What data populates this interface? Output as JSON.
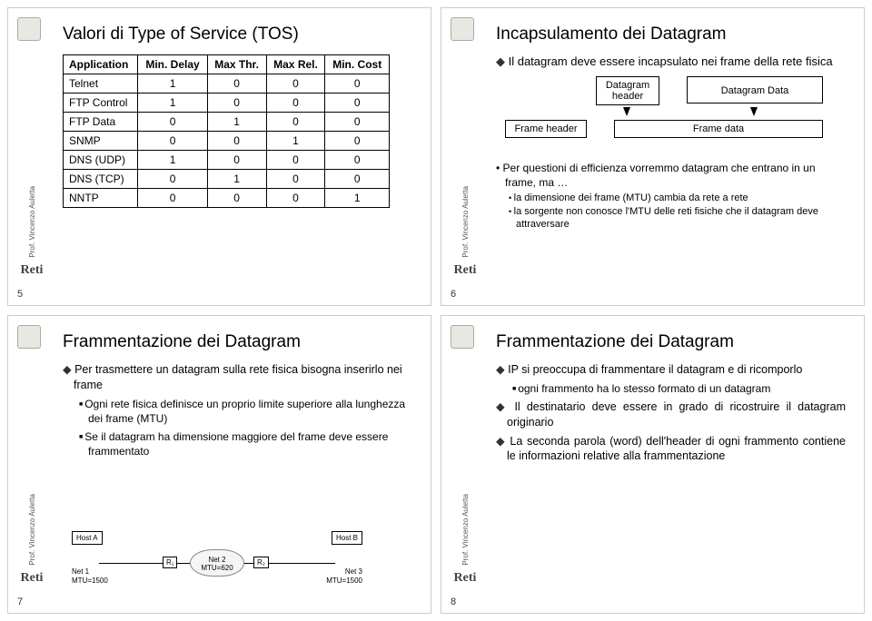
{
  "sidebar_author": "Prof. Vincenzo Auletta",
  "sidebar_logo": "Reti",
  "slide5": {
    "title": "Valori di Type of Service (TOS)",
    "pagenum": "5",
    "table": {
      "headers": [
        "Application",
        "Min. Delay",
        "Max Thr.",
        "Max Rel.",
        "Min. Cost"
      ],
      "rows": [
        {
          "c0": "Telnet",
          "c1": "1",
          "c2": "0",
          "c3": "0",
          "c4": "0"
        },
        {
          "c0": "FTP Control",
          "c1": "1",
          "c2": "0",
          "c3": "0",
          "c4": "0"
        },
        {
          "c0": "FTP Data",
          "c1": "0",
          "c2": "1",
          "c3": "0",
          "c4": "0"
        },
        {
          "c0": "SNMP",
          "c1": "0",
          "c2": "0",
          "c3": "1",
          "c4": "0"
        },
        {
          "c0": "DNS (UDP)",
          "c1": "1",
          "c2": "0",
          "c3": "0",
          "c4": "0"
        },
        {
          "c0": "DNS (TCP)",
          "c1": "0",
          "c2": "1",
          "c3": "0",
          "c4": "0"
        },
        {
          "c0": "NNTP",
          "c1": "0",
          "c2": "0",
          "c3": "0",
          "c4": "1"
        }
      ]
    }
  },
  "slide6": {
    "title": "Incapsulamento dei Datagram",
    "pagenum": "6",
    "lead": "Il datagram deve essere incapsulato nei frame della rete fisica",
    "boxes": {
      "dgram_header": "Datagram header",
      "dgram_data": "Datagram Data",
      "frame_header": "Frame header",
      "frame_data": "Frame data"
    },
    "bullets": {
      "b1": "Per questioni di efficienza vorremmo datagram che entrano in un frame, ma …",
      "s1": "la dimensione dei frame (MTU) cambia da rete a rete",
      "s2": "la sorgente non conosce l'MTU delle reti fisiche che il datagram deve attraversare"
    }
  },
  "slide7": {
    "title": "Frammentazione dei Datagram",
    "pagenum": "7",
    "p1": "Per trasmettere un datagram sulla rete fisica bisogna inserirlo nei frame",
    "p2": "Ogni rete fisica definisce un proprio limite superiore alla lunghezza dei frame (MTU)",
    "p3": "Se il datagram ha dimensione maggiore del frame deve essere frammentato",
    "net": {
      "hostA": "Host\nA",
      "hostB": "Host\nB",
      "r1": "R₁",
      "r2": "R₂",
      "net1": "Net 1",
      "mtu1": "MTU=1500",
      "net2": "Net 2",
      "mtu2": "MTU=620",
      "net3": "Net 3",
      "mtu3": "MTU=1500"
    }
  },
  "slide8": {
    "title": "Frammentazione dei Datagram",
    "pagenum": "8",
    "p1": "IP si preoccupa di frammentare il datagram e di ricomporlo",
    "p2": "ogni frammento ha lo stesso formato di un datagram",
    "p3": "Il destinatario deve essere in grado di ricostruire il datagram originario",
    "p4": "La seconda parola (word) dell'header di ogni frammento contiene le informazioni relative alla frammentazione"
  }
}
